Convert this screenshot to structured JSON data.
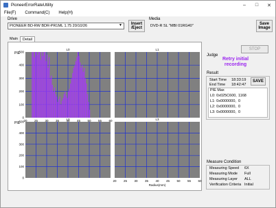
{
  "window": {
    "title": "PioneerErrorRateUtility"
  },
  "menu": {
    "file": "File(F)",
    "command": "Command(C)",
    "help": "Help(H)"
  },
  "drive": {
    "label": "Drive",
    "selected": "PIONEER BD-RW BDR-PR1ML 1.75 20/10/26",
    "insert_eject_line1": "Insert",
    "insert_eject_line2": "/Eject"
  },
  "media": {
    "label": "Media",
    "value": "DVD-R SL \"MBI 01RG40\"",
    "save_image_line1": "Save",
    "save_image_line2": "Image"
  },
  "tabs": [
    {
      "label": "Main"
    },
    {
      "label": "Detail"
    }
  ],
  "stop_label": "STOP",
  "judge": {
    "label": "Judge",
    "line1": "Retry initial",
    "line2": "recording"
  },
  "result": {
    "label": "Result",
    "start_time_label": "Start Time",
    "start_time": "18:33:19",
    "end_time_label": "End Time",
    "end_time": "18:42:47",
    "save_label": "SAVE",
    "pie_max_label": "PIE Max",
    "rows": [
      {
        "key": "L0: 0x025C600,",
        "value": "1168"
      },
      {
        "key": "L1: 0x0000000,",
        "value": "0"
      },
      {
        "key": "L2: 0x0000000,",
        "value": "0"
      },
      {
        "key": "L3: 0x0000000,",
        "value": "0"
      }
    ]
  },
  "measure": {
    "label": "Measure Condition",
    "rows": [
      {
        "key": "Measuring Speed",
        "value": "6X"
      },
      {
        "key": "Measuring Mode",
        "value": "Full"
      },
      {
        "key": "Measuring Layer",
        "value": "ALL"
      },
      {
        "key": "Verification Criteria",
        "value": "Initial"
      }
    ]
  },
  "colors": {
    "plot_bg": "#808080",
    "grid": "#1c2fd6",
    "data": "#a23cf0",
    "judge": "#9b25f0"
  },
  "chart_data": [
    {
      "type": "bar",
      "title": "L0",
      "ylabel": "PIE",
      "xlabel": "Radius(mm)",
      "yticks": [
        "0",
        "100",
        "200",
        "300",
        "400",
        "500"
      ],
      "xticks": [
        "20",
        "25",
        "30",
        "35",
        "40",
        "45",
        "50",
        "55",
        "60"
      ],
      "ylim": [
        0,
        500
      ],
      "xlim": [
        22,
        58
      ],
      "x": [
        23.0,
        23.5,
        24.0,
        24.5,
        25.0,
        25.5,
        26.0,
        26.5,
        27.0,
        27.5,
        28.0,
        28.5,
        29.0,
        29.5,
        30.0,
        30.5,
        31.0,
        31.5,
        32.0,
        32.5,
        33.0,
        33.5,
        34.0,
        34.5,
        35.0,
        35.5,
        36.0,
        36.5,
        37.0,
        37.5,
        38.0,
        38.5,
        39.0,
        39.5,
        40.0,
        40.5,
        41.0,
        41.5,
        42.0,
        42.5,
        43.0,
        43.5,
        44.0,
        44.5,
        45.0,
        45.5,
        46.0,
        46.5,
        47.0,
        47.5,
        48.0,
        48.5,
        49.0,
        49.5,
        50.0
      ],
      "values": [
        500,
        500,
        460,
        500,
        500,
        480,
        500,
        500,
        440,
        500,
        470,
        500,
        500,
        430,
        480,
        380,
        460,
        300,
        320,
        250,
        200,
        230,
        180,
        160,
        120,
        140,
        160,
        100,
        130,
        150,
        180,
        200,
        170,
        150,
        200,
        220,
        260,
        300,
        340,
        380,
        400,
        430,
        460,
        500,
        470,
        420,
        380,
        400,
        350,
        380,
        300,
        260,
        180,
        120,
        60
      ]
    },
    {
      "type": "bar",
      "title": "L1",
      "yticks": [],
      "xticks": [],
      "values": []
    },
    {
      "type": "bar",
      "title": "L2",
      "ylabel": "PIE",
      "yticks": [
        "0",
        "100",
        "200",
        "300",
        "400",
        "500"
      ],
      "values": []
    },
    {
      "type": "bar",
      "title": "L3",
      "xlabel": "Radius(mm)",
      "xticks": [
        "20",
        "25",
        "30",
        "35",
        "40",
        "45",
        "50",
        "55",
        "60"
      ],
      "values": []
    }
  ]
}
